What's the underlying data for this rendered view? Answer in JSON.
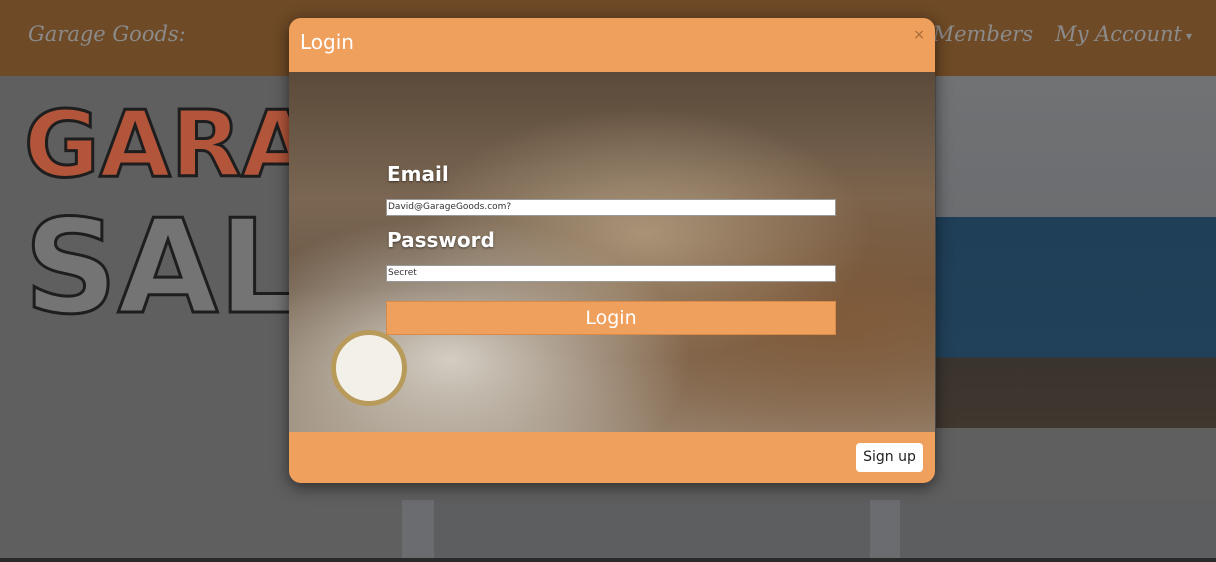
{
  "navbar": {
    "brand": "Garage Goods:",
    "links": [
      "Members",
      "My Account"
    ]
  },
  "banner": {
    "text": "GARAGE SALE"
  },
  "modal": {
    "title": "Login",
    "close": "×",
    "email_label": "Email",
    "email_value": "David@GarageGoods.com?",
    "password_label": "Password",
    "password_value": "Secret",
    "login_button": "Login",
    "signup_button": "Sign up"
  },
  "colors": {
    "accent": "#efa05c",
    "navbar": "#6e4a26",
    "overlay": "#5f5f5f"
  }
}
